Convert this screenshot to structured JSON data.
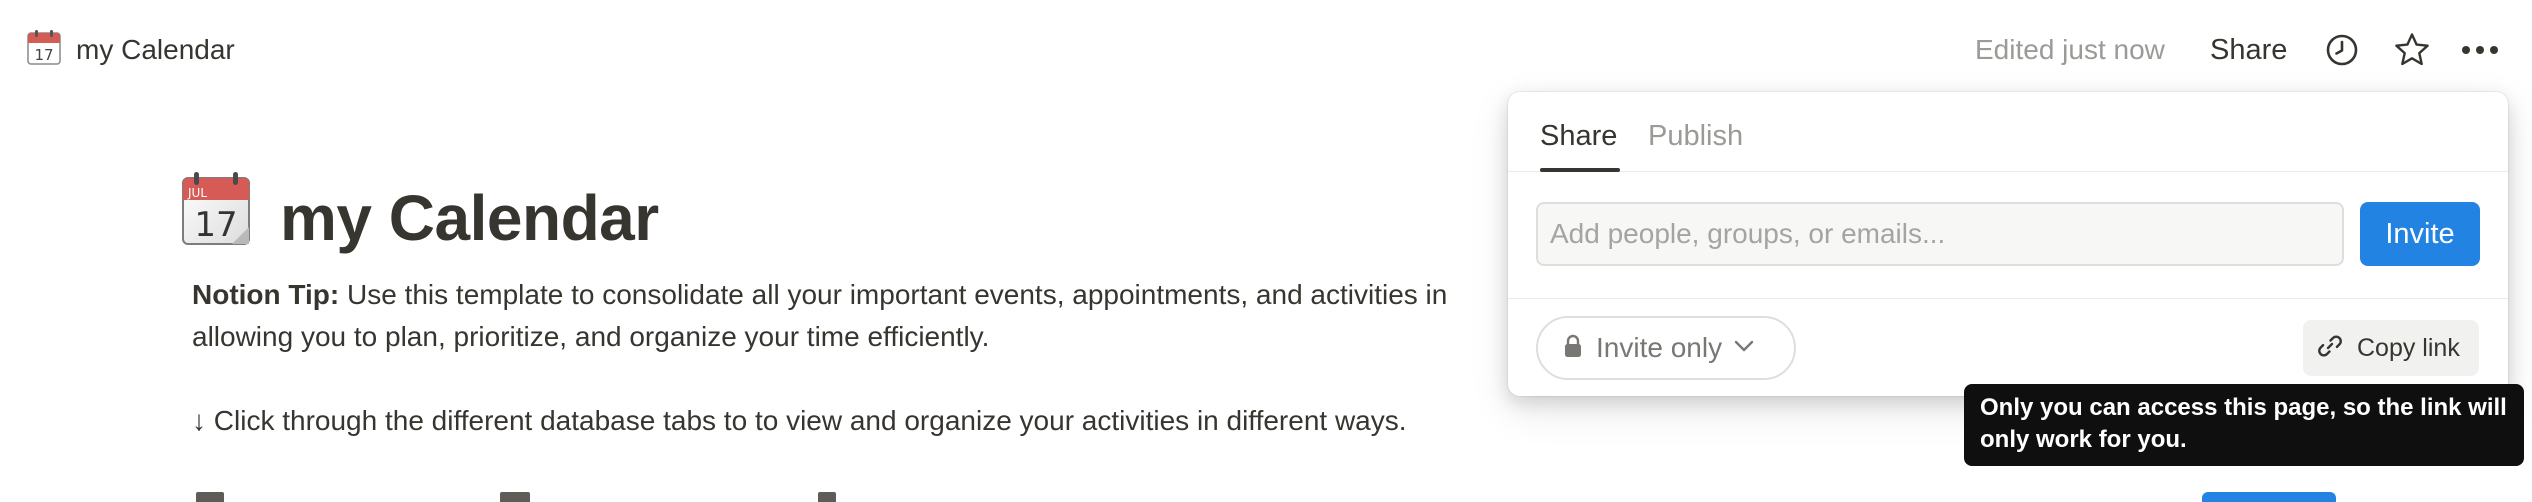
{
  "topbar": {
    "page_icon": "calendar-icon",
    "breadcrumb_title": "my Calendar",
    "edited_status": "Edited just now",
    "share_label": "Share",
    "icons": [
      "clock-icon",
      "star-icon",
      "more-icon"
    ]
  },
  "page": {
    "icon": "calendar-icon",
    "icon_month": "JUL",
    "icon_day": "17",
    "title": "my Calendar",
    "tip_label": "Notion Tip:",
    "tip_line1": " Use this template to consolidate all your important events, appointments, and activities in",
    "tip_line2": "allowing you to plan, prioritize, and organize your time efficiently.",
    "instruction": "↓ Click through the different database tabs to to view and organize your activities in different ways."
  },
  "share_popover": {
    "tabs": [
      {
        "label": "Share",
        "active": true
      },
      {
        "label": "Publish",
        "active": false
      }
    ],
    "invite_placeholder": "Add people, groups, or emails...",
    "invite_value": "",
    "invite_button": "Invite",
    "access_level": "Invite only",
    "copy_link_label": "Copy link"
  },
  "tooltip": {
    "line1": "Only you can access this page, so the link will",
    "line2": "only work for you."
  },
  "colors": {
    "accent": "#2383e2",
    "text": "#37352f",
    "muted": "#9b9a97",
    "tooltip_bg": "#0f0f0f"
  }
}
